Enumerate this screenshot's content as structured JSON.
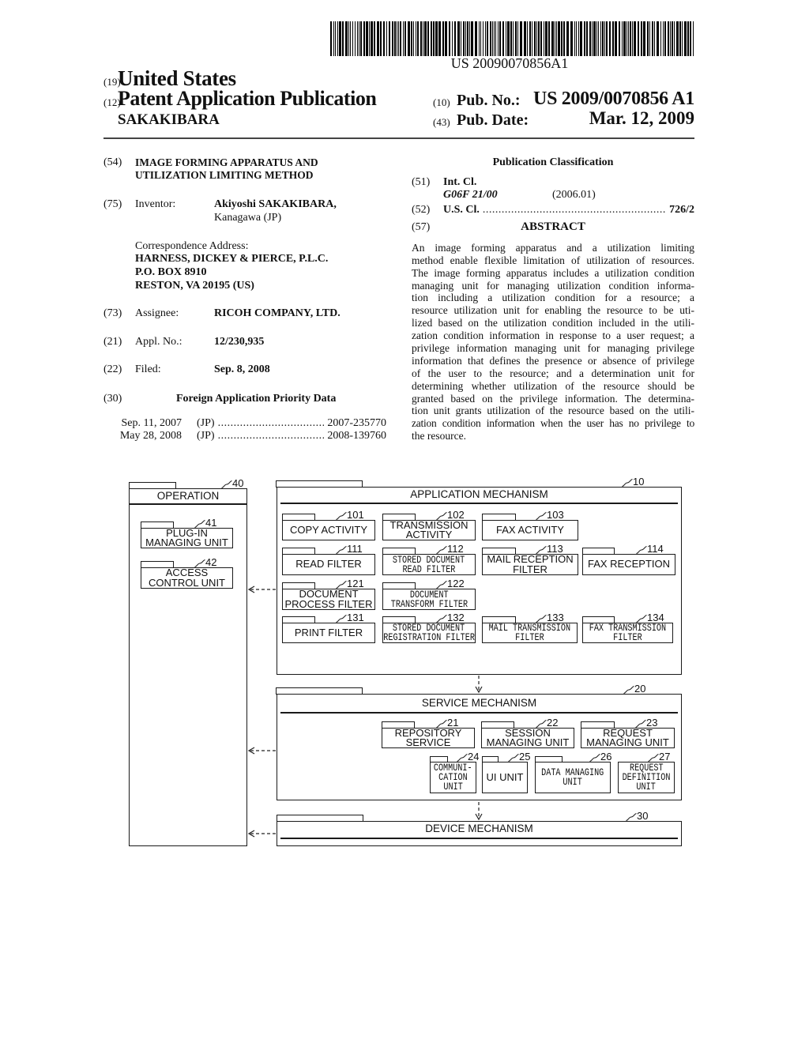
{
  "header": {
    "barcode_text": "US 20090070856A1",
    "country_code": "(19)",
    "country": "United States",
    "doc_type_code": "(12)",
    "doc_type": "Patent Application Publication",
    "applicant": "SAKAKIBARA",
    "pub_no_code": "(10)",
    "pub_no_label": "Pub. No.:",
    "pub_no": "US 2009/0070856 A1",
    "pub_date_code": "(43)",
    "pub_date_label": "Pub. Date:",
    "pub_date": "Mar. 12, 2009"
  },
  "biblio": {
    "title": {
      "code": "(54)",
      "lines": [
        "IMAGE FORMING APPARATUS AND",
        "UTILIZATION LIMITING METHOD"
      ]
    },
    "inventor": {
      "code": "(75)",
      "label": "Inventor:",
      "name": "Akiyoshi SAKAKIBARA,",
      "location": "Kanagawa (JP)"
    },
    "correspondence": {
      "label": "Correspondence Address:",
      "lines": [
        "HARNESS, DICKEY & PIERCE, P.L.C.",
        "P.O. BOX 8910",
        "RESTON, VA 20195 (US)"
      ]
    },
    "assignee": {
      "code": "(73)",
      "label": "Assignee:",
      "value": "RICOH COMPANY, LTD."
    },
    "appl_no": {
      "code": "(21)",
      "label": "Appl. No.:",
      "value": "12/230,935"
    },
    "filed": {
      "code": "(22)",
      "label": "Filed:",
      "value": "Sep. 8, 2008"
    },
    "priority": {
      "code": "(30)",
      "heading": "Foreign Application Priority Data",
      "entries": [
        {
          "date": "Sep. 11, 2007",
          "country": "(JP)",
          "number": "2007-235770"
        },
        {
          "date": "May 28, 2008",
          "country": "(JP)",
          "number": "2008-139760"
        }
      ]
    }
  },
  "classification": {
    "heading": "Publication Classification",
    "int_cl": {
      "code": "(51)",
      "label": "Int. Cl.",
      "class": "G06F 21/00",
      "version": "(2006.01)"
    },
    "us_cl": {
      "code": "(52)",
      "label": "U.S. Cl.",
      "value": "726/2"
    },
    "abstract": {
      "code": "(57)",
      "heading": "ABSTRACT",
      "lines": [
        "An image forming apparatus and a utilization limiting",
        "method enable flexible limitation of utilization of resources.",
        "The image forming apparatus includes a utilization condition",
        "managing unit for managing utilization condition informa-",
        "tion including a utilization condition for a resource; a",
        "resource utilization unit for enabling the resource to be uti-",
        "lized based on the utilization condition included in the utili-",
        "zation condition information in response to a user request; a",
        "privilege information managing unit for managing privilege",
        "information that defines the presence or absence of privilege",
        "of the user to the resource; and a determination unit for",
        "determining whether utilization of the resource should be",
        "granted based on the privilege information. The determina-",
        "tion unit grants utilization of the resource based on the utili-",
        "zation condition information when the user has no privilege to",
        "the resource."
      ]
    }
  },
  "figure": {
    "operation": {
      "ref": "40",
      "title": "OPERATION",
      "units": [
        {
          "ref": "41",
          "lines": [
            "PLUG-IN",
            "MANAGING UNIT"
          ]
        },
        {
          "ref": "42",
          "lines": [
            "ACCESS",
            "CONTROL UNIT"
          ]
        }
      ]
    },
    "application": {
      "ref": "10",
      "title": "APPLICATION MECHANISM",
      "components": [
        {
          "ref": "101",
          "lines": [
            "COPY ACTIVITY"
          ]
        },
        {
          "ref": "102",
          "lines": [
            "TRANSMISSION",
            "ACTIVITY"
          ]
        },
        {
          "ref": "103",
          "lines": [
            "FAX ACTIVITY"
          ]
        },
        {
          "ref": "111",
          "lines": [
            "READ FILTER"
          ]
        },
        {
          "ref": "112",
          "lines": [
            "STORED DOCUMENT",
            "READ FILTER"
          ]
        },
        {
          "ref": "113",
          "lines": [
            "MAIL RECEPTION",
            "FILTER"
          ]
        },
        {
          "ref": "114",
          "lines": [
            "FAX RECEPTION"
          ]
        },
        {
          "ref": "121",
          "lines": [
            "DOCUMENT",
            "PROCESS FILTER"
          ]
        },
        {
          "ref": "122",
          "lines": [
            "DOCUMENT",
            "TRANSFORM FILTER"
          ]
        },
        {
          "ref": "131",
          "lines": [
            "PRINT FILTER"
          ]
        },
        {
          "ref": "132",
          "lines": [
            "STORED DOCUMENT",
            "REGISTRATION FILTER"
          ]
        },
        {
          "ref": "133",
          "lines": [
            "MAIL TRANSMISSION",
            "FILTER"
          ]
        },
        {
          "ref": "134",
          "lines": [
            "FAX TRANSMISSION",
            "FILTER"
          ]
        }
      ]
    },
    "service": {
      "ref": "20",
      "title": "SERVICE MECHANISM",
      "components": [
        {
          "ref": "21",
          "lines": [
            "REPOSITORY",
            "SERVICE"
          ]
        },
        {
          "ref": "22",
          "lines": [
            "SESSION",
            "MANAGING UNIT"
          ]
        },
        {
          "ref": "23",
          "lines": [
            "REQUEST",
            "MANAGING UNIT"
          ]
        },
        {
          "ref": "24",
          "lines": [
            "COMMUNI-",
            "CATION",
            "UNIT"
          ]
        },
        {
          "ref": "25",
          "lines": [
            "UI UNIT"
          ]
        },
        {
          "ref": "26",
          "lines": [
            "DATA MANAGING",
            "UNIT"
          ]
        },
        {
          "ref": "27",
          "lines": [
            "REQUEST",
            "DEFINITION",
            "UNIT"
          ]
        }
      ]
    },
    "device": {
      "ref": "30",
      "title": "DEVICE MECHANISM"
    }
  }
}
